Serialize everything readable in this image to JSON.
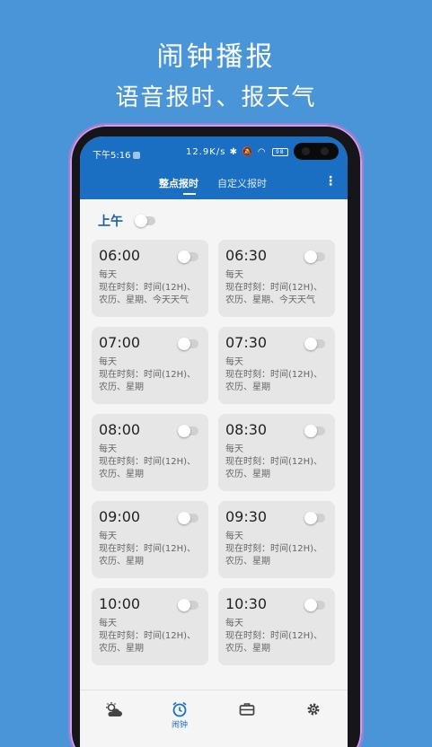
{
  "promo": {
    "title": "闹钟播报",
    "subtitle": "语音报时、报天气"
  },
  "status_bar": {
    "time": "下午5:16",
    "network": "12.9K/s",
    "battery": "98"
  },
  "tabs": [
    {
      "label": "整点报时",
      "active": true
    },
    {
      "label": "自定义报时",
      "active": false
    }
  ],
  "section": {
    "title": "上午",
    "enabled": false
  },
  "alarms": [
    {
      "time": "06:00",
      "repeat": "每天",
      "line1": "现在时刻：时间(12H)、",
      "line2": "农历、星期、今天天气"
    },
    {
      "time": "06:30",
      "repeat": "每天",
      "line1": "现在时刻：时间(12H)、",
      "line2": "农历、星期、今天天气"
    },
    {
      "time": "07:00",
      "repeat": "每天",
      "line1": "现在时刻：时间(12H)、",
      "line2": "农历、星期"
    },
    {
      "time": "07:30",
      "repeat": "每天",
      "line1": "现在时刻：时间(12H)、",
      "line2": "农历、星期"
    },
    {
      "time": "08:00",
      "repeat": "每天",
      "line1": "现在时刻：时间(12H)、",
      "line2": "农历、星期"
    },
    {
      "time": "08:30",
      "repeat": "每天",
      "line1": "现在时刻：时间(12H)、",
      "line2": "农历、星期"
    },
    {
      "time": "09:00",
      "repeat": "每天",
      "line1": "现在时刻：时间(12H)、",
      "line2": "农历、星期"
    },
    {
      "time": "09:30",
      "repeat": "每天",
      "line1": "现在时刻：时间(12H)、",
      "line2": "农历、星期"
    },
    {
      "time": "10:00",
      "repeat": "每天",
      "line1": "现在时刻：时间(12H)、",
      "line2": "农历、星期"
    },
    {
      "time": "10:30",
      "repeat": "每天",
      "line1": "现在时刻：时间(12H)、",
      "line2": "农历、星期"
    }
  ],
  "bottom_nav": [
    {
      "icon": "weather-icon",
      "label": ""
    },
    {
      "icon": "alarm-clock-icon",
      "label": "闹钟"
    },
    {
      "icon": "toolbox-icon",
      "label": ""
    },
    {
      "icon": "gear-icon",
      "label": ""
    }
  ],
  "colors": {
    "background": "#4a95d8",
    "header": "#1a6fc2",
    "accent_text": "#1f5ea4"
  }
}
